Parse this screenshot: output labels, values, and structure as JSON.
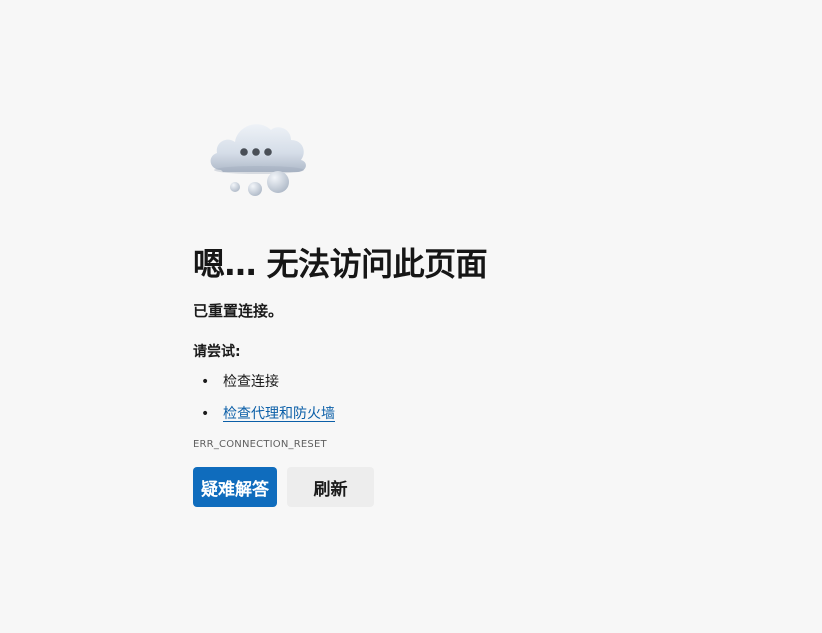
{
  "error_page": {
    "illustration_icon": "cloud-thinking-icon",
    "title": "嗯… 无法访问此页面",
    "subtitle": "已重置连接。",
    "try_heading": "请尝试:",
    "suggestions": [
      {
        "text": "检查连接",
        "is_link": false
      },
      {
        "text": "检查代理和防火墙",
        "is_link": true
      }
    ],
    "bullet": "•",
    "error_code": "ERR_CONNECTION_RESET",
    "buttons": {
      "troubleshoot_label": "疑难解答",
      "refresh_label": "刷新"
    }
  },
  "colors": {
    "background": "#f7f7f7",
    "primary_button": "#0f6cbd",
    "secondary_button": "#ededed",
    "link": "#0b5fa8"
  }
}
